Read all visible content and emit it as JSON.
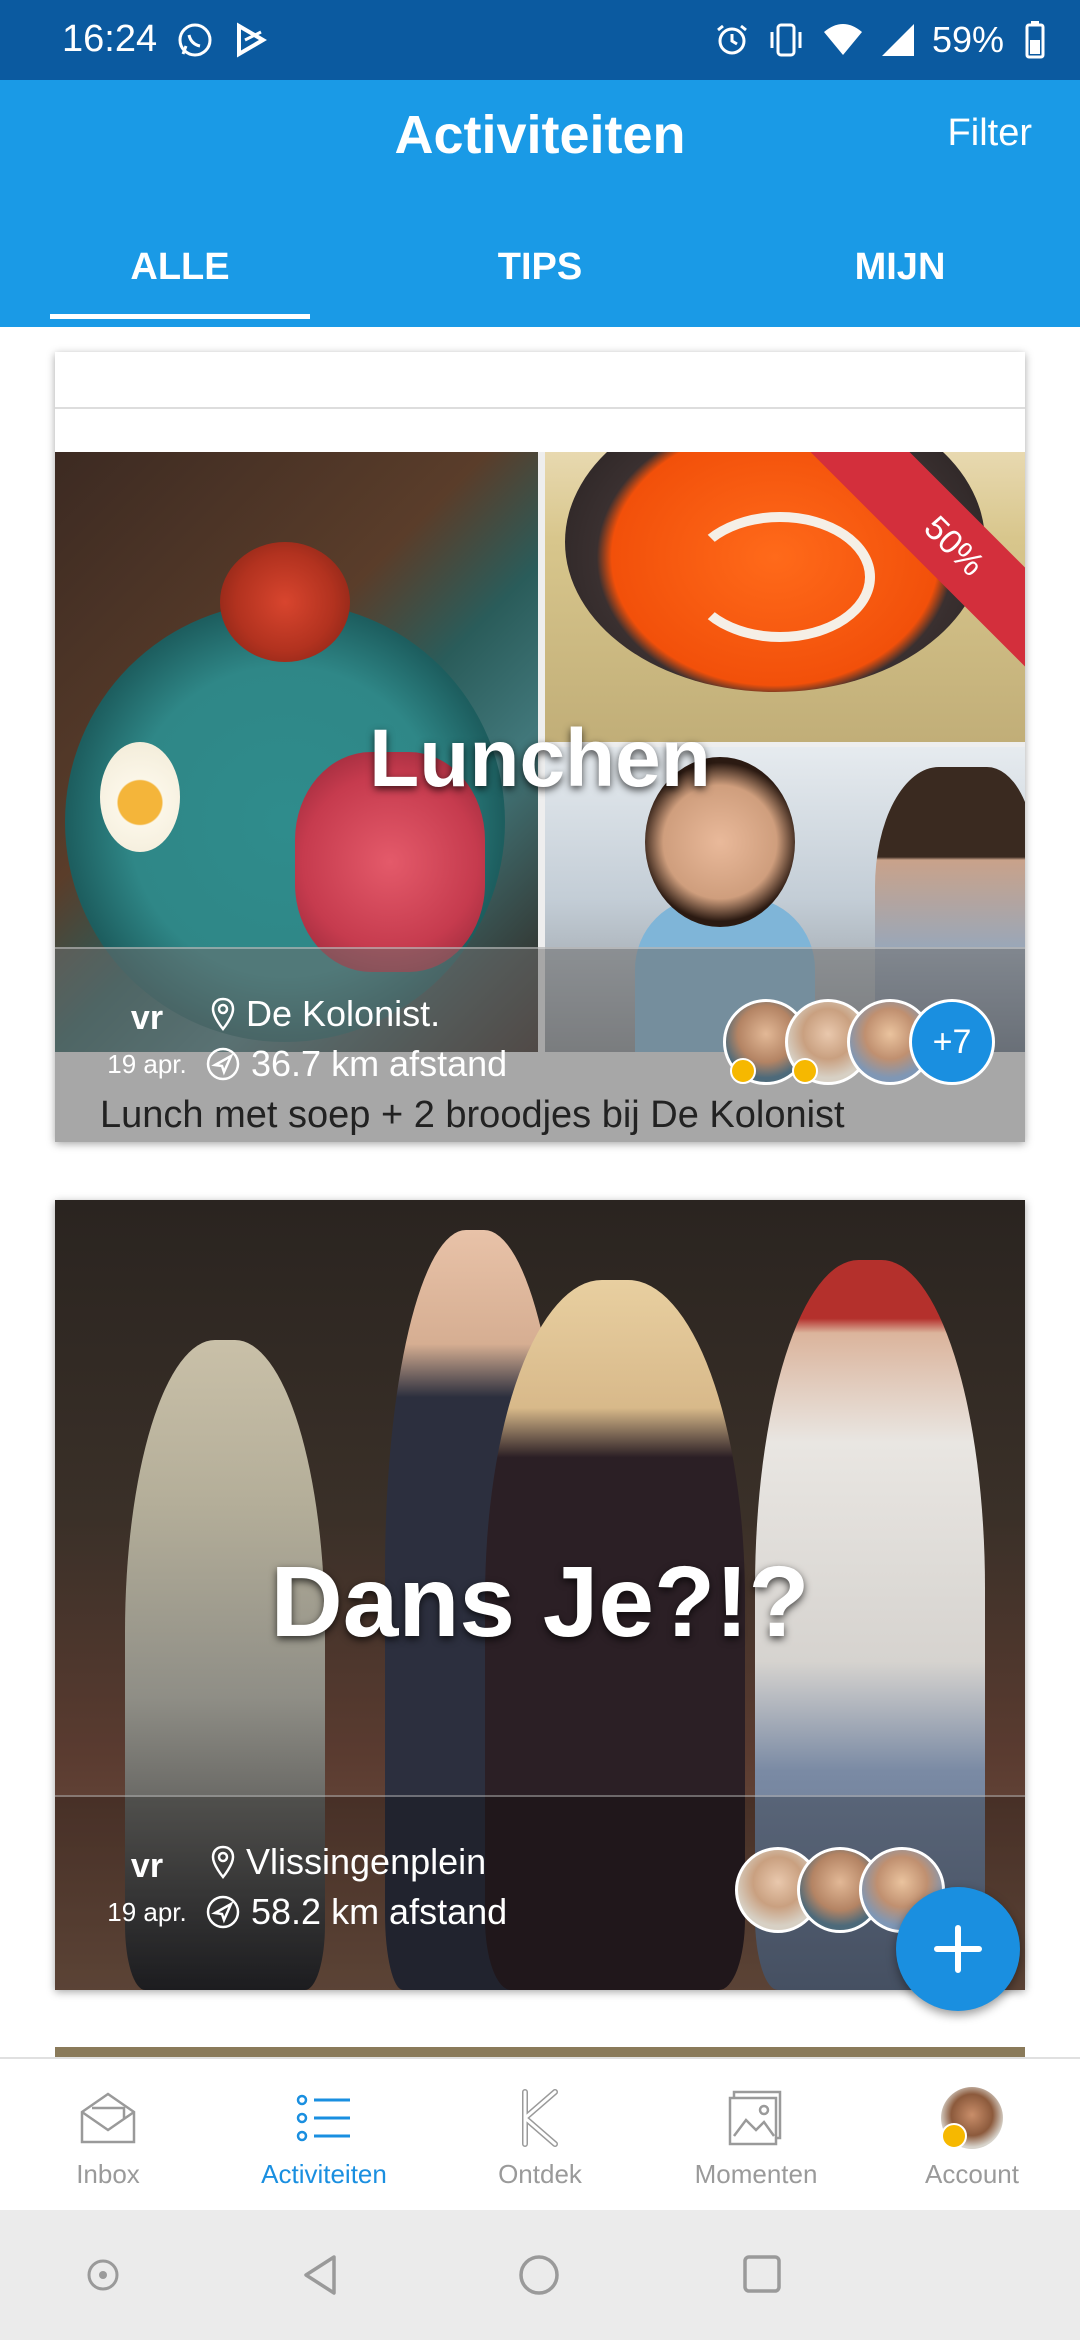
{
  "status_bar": {
    "time": "16:24",
    "battery": "59%",
    "icons_left": [
      "whatsapp-icon",
      "play-store-icon"
    ],
    "icons_right": [
      "alarm-icon",
      "vibrate-icon",
      "wifi-icon",
      "signal-icon",
      "battery-icon"
    ]
  },
  "header": {
    "title": "Activiteiten",
    "filter_label": "Filter"
  },
  "tabs": [
    {
      "label": "ALLE",
      "active": true
    },
    {
      "label": "TIPS",
      "active": false
    },
    {
      "label": "MIJN",
      "active": false
    }
  ],
  "cards": [
    {
      "title": "Lunchen",
      "badge": "50%",
      "day": "vr",
      "date": "19 apr.",
      "location": "De Kolonist.",
      "distance": "36.7 km afstand",
      "description": "Lunch met soep + 2 broodjes bij De Kolonist",
      "extra_participants": "+7"
    },
    {
      "title": "Dans Je?!?",
      "day": "vr",
      "date": "19 apr.",
      "location": "Vlissingenplein",
      "distance": "58.2 km afstand"
    }
  ],
  "bottom_nav": [
    {
      "label": "Inbox",
      "icon": "inbox-icon",
      "active": false
    },
    {
      "label": "Activiteiten",
      "icon": "list-icon",
      "active": true
    },
    {
      "label": "Ontdek",
      "icon": "discover-icon",
      "active": false
    },
    {
      "label": "Momenten",
      "icon": "photos-icon",
      "active": false
    },
    {
      "label": "Account",
      "icon": "account-avatar",
      "active": false
    }
  ],
  "colors": {
    "status_bar": "#0b5aa0",
    "app_bar": "#1a9ae6",
    "accent": "#1a8fe0",
    "badge": "#d32f3c"
  }
}
